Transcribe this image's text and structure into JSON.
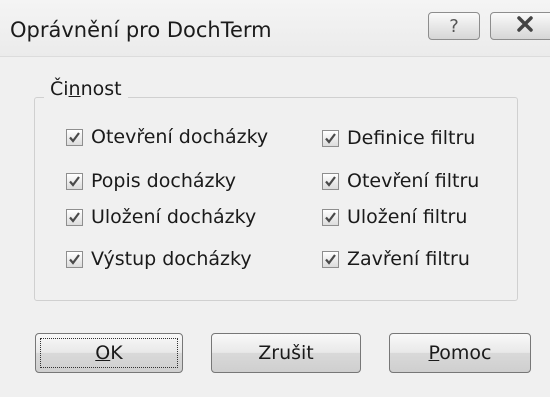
{
  "window": {
    "title": "Oprávnění pro DochTerm",
    "help_glyph": "?",
    "close_glyph": "✕"
  },
  "group": {
    "label_pre": "Či",
    "label_mnemonic": "n",
    "label_post": "nost",
    "checkboxes": [
      {
        "label": "Otevření docházky",
        "checked": true
      },
      {
        "label": "Popis docházky",
        "checked": true
      },
      {
        "label": "Uložení docházky",
        "checked": true
      },
      {
        "label": "Výstup docházky",
        "checked": true
      },
      {
        "label": "Definice filtru",
        "checked": true
      },
      {
        "label": "Otevření filtru",
        "checked": true
      },
      {
        "label": "Uložení filtru",
        "checked": true
      },
      {
        "label": "Zavření filtru",
        "checked": true
      }
    ]
  },
  "buttons": {
    "ok_mnemonic": "O",
    "ok_rest": "K",
    "cancel": "Zrušit",
    "help_mnemonic": "P",
    "help_rest": "omoc"
  },
  "colors": {
    "window_bg": "#f0f0f0",
    "close_button": "#c24f4f"
  }
}
